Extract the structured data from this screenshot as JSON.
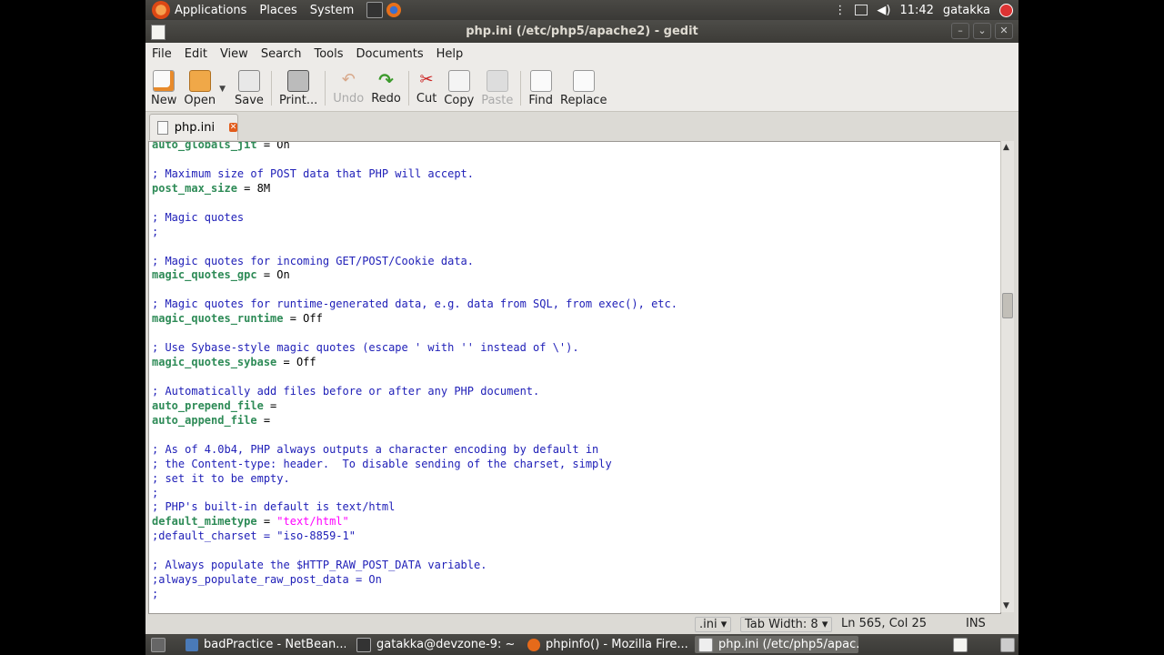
{
  "top_panel": {
    "menus": [
      "Applications",
      "Places",
      "System"
    ],
    "time": "11:42",
    "user": "gatakka"
  },
  "window": {
    "title": "php.ini (/etc/php5/apache2) - gedit"
  },
  "menubar": [
    "File",
    "Edit",
    "View",
    "Search",
    "Tools",
    "Documents",
    "Help"
  ],
  "toolbar": {
    "new": "New",
    "open": "Open",
    "save": "Save",
    "print": "Print...",
    "undo": "Undo",
    "redo": "Redo",
    "cut": "Cut",
    "copy": "Copy",
    "paste": "Paste",
    "find": "Find",
    "replace": "Replace"
  },
  "tab": {
    "label": "php.ini"
  },
  "code_lines": [
    {
      "key": "auto_globals_jit",
      "rest": " = On"
    },
    {},
    {
      "comment": "; Maximum size of POST data that PHP will accept."
    },
    {
      "key": "post_max_size",
      "rest": " = 8M"
    },
    {},
    {
      "comment": "; Magic quotes"
    },
    {
      "comment": ";"
    },
    {},
    {
      "comment": "; Magic quotes for incoming GET/POST/Cookie data."
    },
    {
      "key": "magic_quotes_gpc",
      "rest": " = On"
    },
    {},
    {
      "comment": "; Magic quotes for runtime-generated data, e.g. data from SQL, from exec(), etc."
    },
    {
      "key": "magic_quotes_runtime",
      "rest": " = Off"
    },
    {},
    {
      "comment": "; Use Sybase-style magic quotes (escape ' with '' instead of \\')."
    },
    {
      "key": "magic_quotes_sybase",
      "rest": " = Off"
    },
    {},
    {
      "comment": "; Automatically add files before or after any PHP document."
    },
    {
      "key": "auto_prepend_file",
      "rest": " ="
    },
    {
      "key": "auto_append_file",
      "rest": " ="
    },
    {},
    {
      "comment": "; As of 4.0b4, PHP always outputs a character encoding by default in"
    },
    {
      "comment": "; the Content-type: header.  To disable sending of the charset, simply"
    },
    {
      "comment": "; set it to be empty."
    },
    {
      "comment": ";"
    },
    {
      "comment": "; PHP's built-in default is text/html"
    },
    {
      "key": "default_mimetype",
      "rest": " = ",
      "string": "\"text/html\""
    },
    {
      "comment": ";default_charset = \"iso-8859-1\""
    },
    {},
    {
      "comment": "; Always populate the $HTTP_RAW_POST_DATA variable."
    },
    {
      "comment": ";always_populate_raw_post_data = On"
    },
    {
      "comment": ";"
    }
  ],
  "statusbar": {
    "language": ".ini",
    "tab_width": "Tab Width:  8",
    "position": "Ln 565, Col 25",
    "mode": "INS"
  },
  "taskbar": [
    {
      "label": "badPractice - NetBean...",
      "color": "#4a7ab8"
    },
    {
      "label": "gatakka@devzone-9: ~",
      "color": "#333"
    },
    {
      "label": "phpinfo() - Mozilla Fire...",
      "color": "#e66a1a"
    },
    {
      "label": "php.ini (/etc/php5/apac...",
      "color": "#eee",
      "active": true
    }
  ],
  "colors": {
    "comment": "#2020b8",
    "keyword": "#2e8b57",
    "string": "#ff00ff"
  }
}
